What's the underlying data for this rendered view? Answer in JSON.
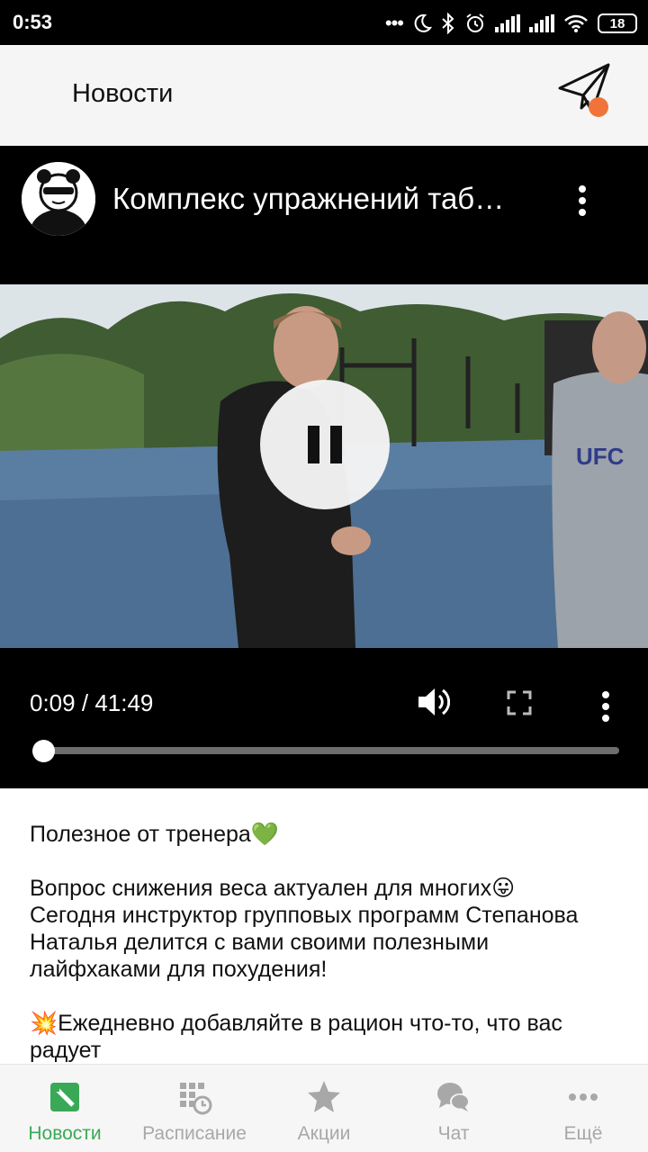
{
  "status_bar": {
    "time": "0:53",
    "battery": "18",
    "icons": [
      "more-dots-icon",
      "moon-icon",
      "bluetooth-icon",
      "alarm-icon",
      "signal-icon",
      "signal-icon",
      "wifi-icon",
      "battery-icon"
    ]
  },
  "header": {
    "title": "Новости",
    "action_icon": "paper-plane-icon",
    "notification_color": "#f0743a"
  },
  "video": {
    "title": "Комплекс упражнений таб…",
    "channel_avatar": "panda-avatar",
    "state": "playing",
    "current_time": "0:09",
    "separator": "/",
    "duration": "41:49",
    "progress_fraction": 0.004,
    "controls": [
      "pause-icon",
      "volume-icon",
      "fullscreen-icon",
      "more-vert-icon"
    ]
  },
  "post": {
    "paragraphs": [
      "Полезное от тренера💚",
      "Вопрос снижения веса актуален для многих😛\nСегодня инструктор групповых программ Степанова Наталья делится с вами своими полезными лайфхаками для похудения!",
      "💥Ежедневно добавляйте в рацион что-то, что вас радует"
    ]
  },
  "bottom_nav": {
    "items": [
      {
        "label": "Новости",
        "icon": "news-icon",
        "active": true
      },
      {
        "label": "Расписание",
        "icon": "schedule-icon",
        "active": false
      },
      {
        "label": "Акции",
        "icon": "star-icon",
        "active": false
      },
      {
        "label": "Чат",
        "icon": "chat-icon",
        "active": false
      },
      {
        "label": "Ещё",
        "icon": "more-dots-icon",
        "active": false
      }
    ],
    "active_color": "#3aa957",
    "inactive_color": "#a8a8a8"
  }
}
